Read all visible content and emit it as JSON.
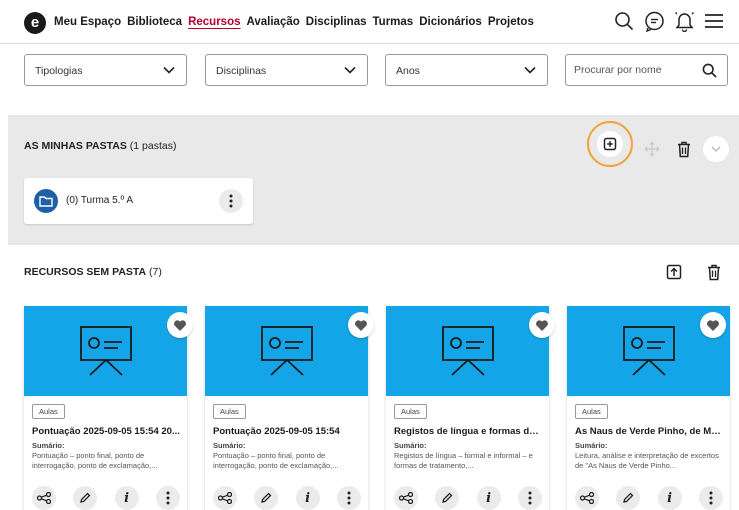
{
  "app": {
    "logo_letter": "e"
  },
  "nav": {
    "items": [
      "Meu Espaço",
      "Biblioteca",
      "Recursos",
      "Avaliação",
      "Disciplinas",
      "Turmas",
      "Dicionários",
      "Projetos"
    ],
    "active": "Recursos",
    "accent": "#b4002d"
  },
  "header_icons": [
    "search-icon",
    "chat-icon",
    "bell-icon",
    "menu-icon"
  ],
  "filters": {
    "tipologias": "Tipologias",
    "disciplinas": "Disciplinas",
    "anos": "Anos",
    "search_placeholder": "Procurar por nome"
  },
  "folders": {
    "title": "AS MINHAS PASTAS",
    "count": "(1 pastas)",
    "items": [
      {
        "name": "(0) Turma 5.º A"
      }
    ],
    "highlight_color": "#f2a33a"
  },
  "resources": {
    "title": "RECURSOS SEM PASTA",
    "count": "(7)",
    "thumb_color": "#14a5e9",
    "cards": [
      {
        "tag": "Aulas",
        "title": "Pontuação 2025-09-05 15:54 20...",
        "summary_label": "Sumário:",
        "summary": "Pontuação – ponto final, ponto de interrogação, ponto de exclamação,..."
      },
      {
        "tag": "Aulas",
        "title": "Pontuação 2025-09-05 15:54",
        "summary_label": "Sumário:",
        "summary": "Pontuação – ponto final, ponto de interrogação, ponto de exclamação,..."
      },
      {
        "tag": "Aulas",
        "title": "Registos de língua e formas de ...",
        "summary_label": "Sumário:",
        "summary": "Registos de língua – formal e informal – e formas de tratamento,..."
      },
      {
        "tag": "Aulas",
        "title": "As Naus de Verde Pinho, de Ma...",
        "summary_label": "Sumário:",
        "summary": "Leitura, análise e interpretação de excertos de \"As Naus de Verde Pinho..."
      }
    ]
  }
}
